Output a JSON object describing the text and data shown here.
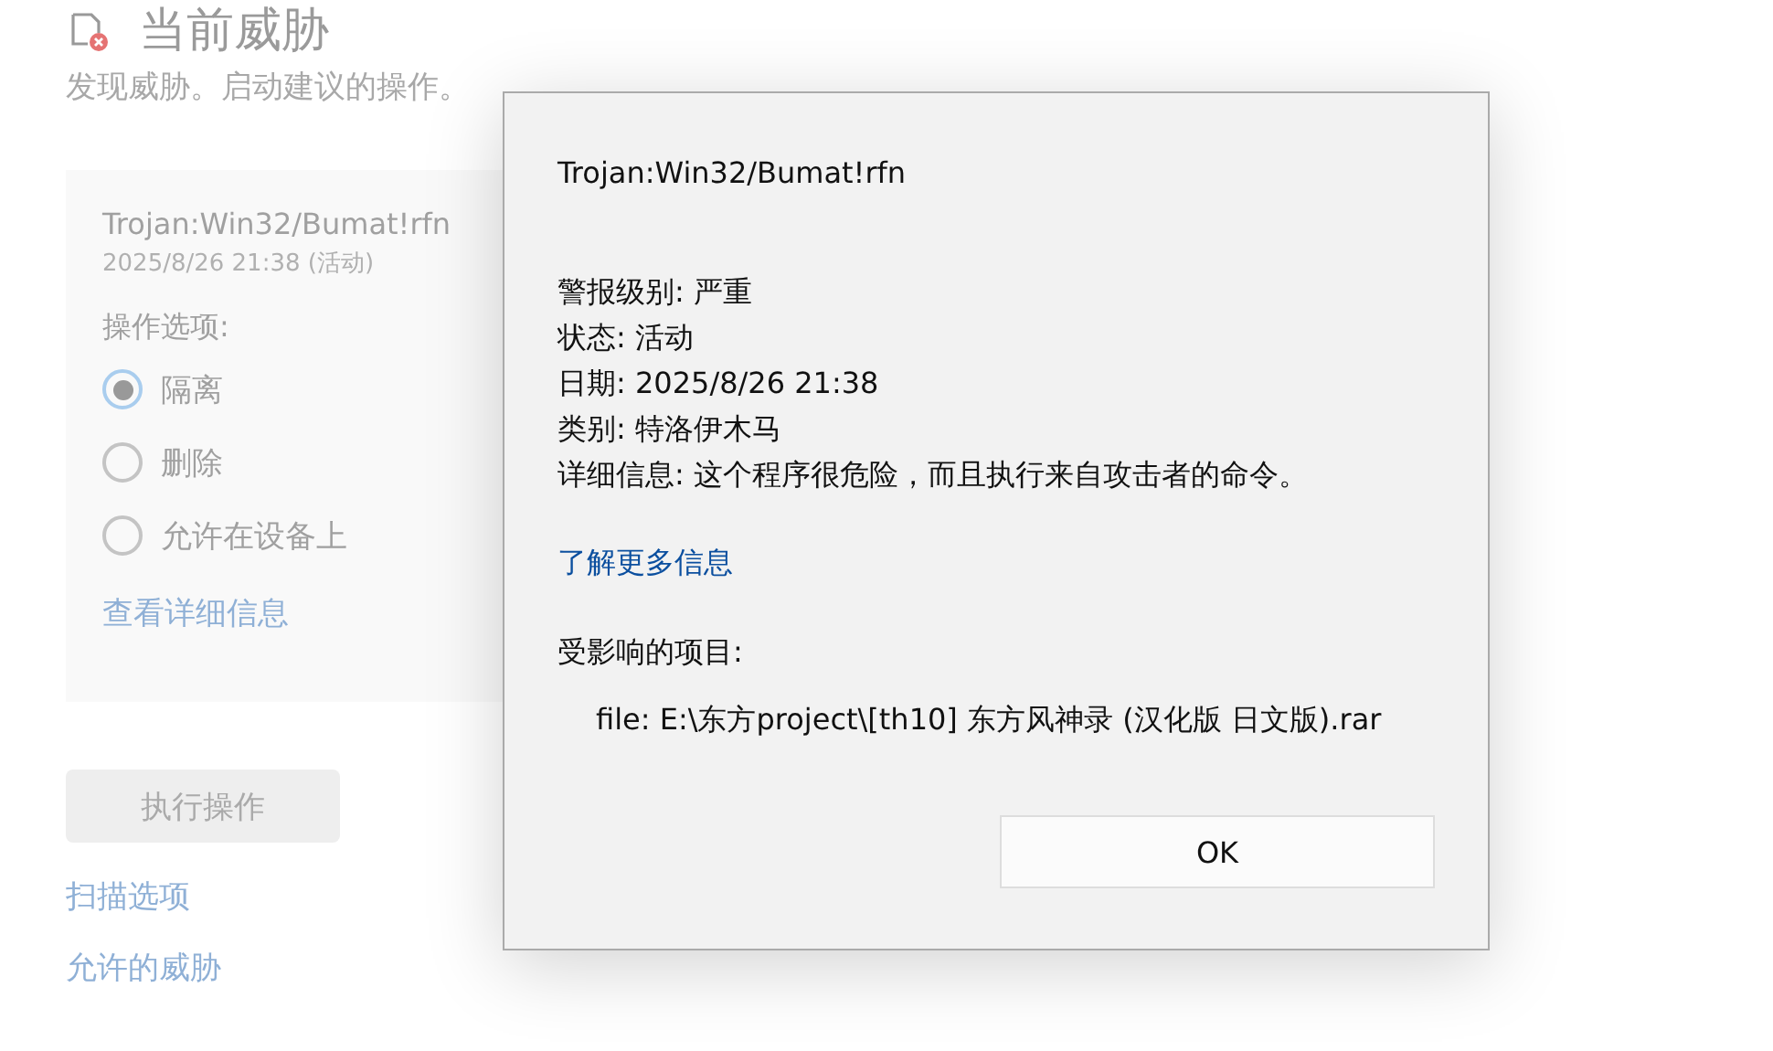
{
  "page": {
    "title": "当前威胁",
    "subtitle": "发现威胁。启动建议的操作。",
    "threat": {
      "name": "Trojan:Win32/Bumat!rfn",
      "meta": "2025/8/26 21:38 (活动)",
      "options_label": "操作选项:",
      "options": [
        {
          "label": "隔离",
          "selected": true
        },
        {
          "label": "删除",
          "selected": false
        },
        {
          "label": "允许在设备上",
          "selected": false
        }
      ],
      "details_link": "查看详细信息"
    },
    "action_button": {
      "label": "执行操作",
      "disabled": true
    },
    "links": [
      "扫描选项",
      "允许的威胁"
    ]
  },
  "dialog": {
    "title": "Trojan:Win32/Bumat!rfn",
    "details": [
      "警报级别: 严重",
      "状态: 活动",
      "日期: 2025/8/26 21:38",
      "类别: 特洛伊木马",
      "详细信息: 这个程序很危险，而且执行来自攻击者的命令。"
    ],
    "link": "了解更多信息",
    "affected_label": "受影响的项目:",
    "affected_items": [
      "file: E:\\东方project\\[th10] 东方风神录 (汉化版 日文版).rar"
    ],
    "ok_button": "OK"
  }
}
